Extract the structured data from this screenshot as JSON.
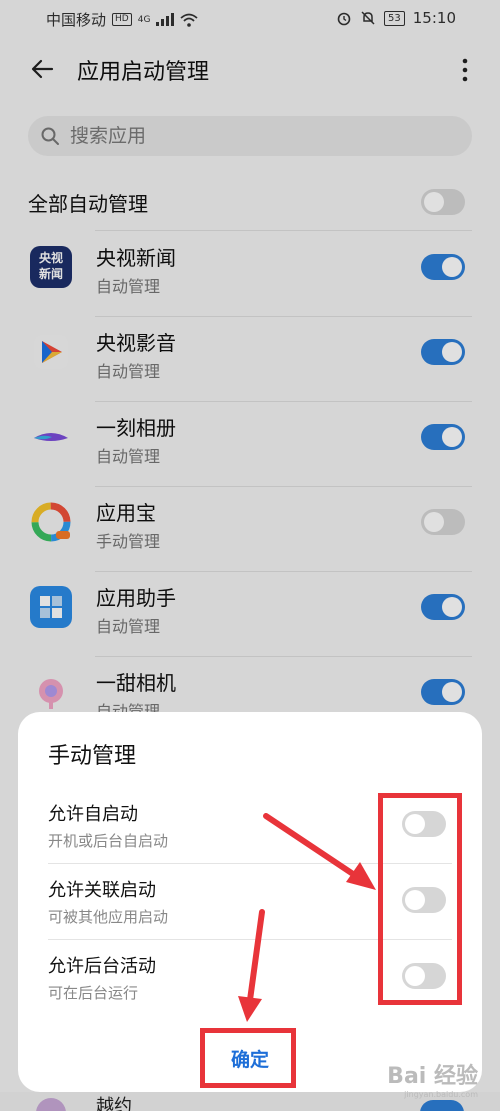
{
  "status": {
    "carrier": "中国移动",
    "network_badge": "HD",
    "net_type": "4G",
    "battery": "53",
    "time": "15:10"
  },
  "header": {
    "title": "应用启动管理"
  },
  "search": {
    "placeholder": "搜索应用"
  },
  "all_manage": {
    "label": "全部自动管理",
    "state": "off"
  },
  "apps": [
    {
      "name": "央视新闻",
      "mode": "自动管理",
      "state": "on",
      "icon_text": "央视新闻"
    },
    {
      "name": "央视影音",
      "mode": "自动管理",
      "state": "on"
    },
    {
      "name": "一刻相册",
      "mode": "自动管理",
      "state": "on"
    },
    {
      "name": "应用宝",
      "mode": "手动管理",
      "state": "off"
    },
    {
      "name": "应用助手",
      "mode": "自动管理",
      "state": "on"
    },
    {
      "name": "一甜相机",
      "mode": "自动管理",
      "state": "on"
    }
  ],
  "dialog": {
    "title": "手动管理",
    "rows": [
      {
        "name": "允许自启动",
        "desc": "开机或后台自启动",
        "state": "off"
      },
      {
        "name": "允许关联启动",
        "desc": "可被其他应用启动",
        "state": "off"
      },
      {
        "name": "允许后台活动",
        "desc": "可在后台运行",
        "state": "off"
      }
    ],
    "confirm": "确定"
  },
  "bottom_app": {
    "name": "越约"
  },
  "watermark": {
    "text": "Bai 经验",
    "sub": "jingyan.baidu.com"
  },
  "colors": {
    "toggle_on": "#2d7fd8",
    "toggle_off": "#d6d6d6",
    "annotation": "#e8343a",
    "accent": "#1e6fd8"
  }
}
